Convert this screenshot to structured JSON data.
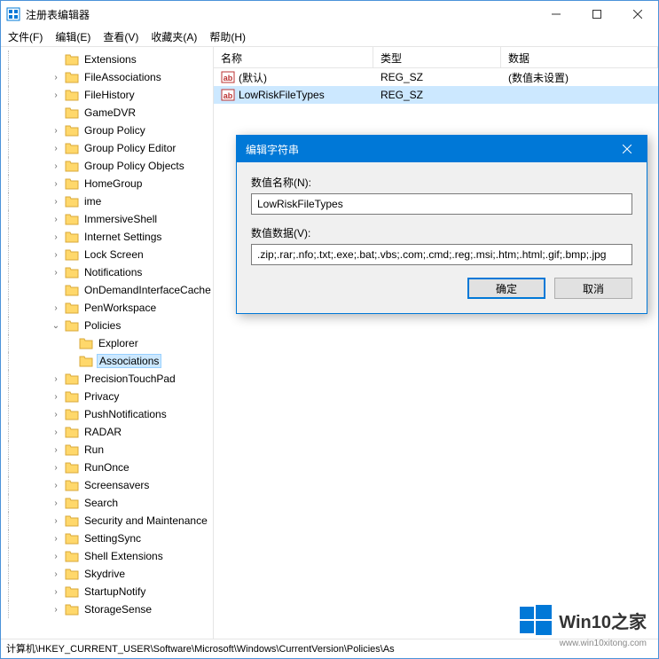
{
  "window": {
    "title": "注册表编辑器"
  },
  "menu": {
    "file": "文件(F)",
    "edit": "编辑(E)",
    "view": "查看(V)",
    "favorites": "收藏夹(A)",
    "help": "帮助(H)"
  },
  "tree": {
    "items": [
      {
        "indent": 3,
        "exp": "",
        "label": "Extensions"
      },
      {
        "indent": 3,
        "exp": ">",
        "label": "FileAssociations"
      },
      {
        "indent": 3,
        "exp": ">",
        "label": "FileHistory"
      },
      {
        "indent": 3,
        "exp": "",
        "label": "GameDVR"
      },
      {
        "indent": 3,
        "exp": ">",
        "label": "Group Policy"
      },
      {
        "indent": 3,
        "exp": ">",
        "label": "Group Policy Editor"
      },
      {
        "indent": 3,
        "exp": ">",
        "label": "Group Policy Objects"
      },
      {
        "indent": 3,
        "exp": ">",
        "label": "HomeGroup"
      },
      {
        "indent": 3,
        "exp": ">",
        "label": "ime"
      },
      {
        "indent": 3,
        "exp": ">",
        "label": "ImmersiveShell"
      },
      {
        "indent": 3,
        "exp": ">",
        "label": "Internet Settings"
      },
      {
        "indent": 3,
        "exp": ">",
        "label": "Lock Screen"
      },
      {
        "indent": 3,
        "exp": ">",
        "label": "Notifications"
      },
      {
        "indent": 3,
        "exp": "",
        "label": "OnDemandInterfaceCache"
      },
      {
        "indent": 3,
        "exp": ">",
        "label": "PenWorkspace"
      },
      {
        "indent": 3,
        "exp": "v",
        "label": "Policies"
      },
      {
        "indent": 4,
        "exp": "",
        "label": "Explorer"
      },
      {
        "indent": 4,
        "exp": "",
        "label": "Associations",
        "selected": true
      },
      {
        "indent": 3,
        "exp": ">",
        "label": "PrecisionTouchPad"
      },
      {
        "indent": 3,
        "exp": ">",
        "label": "Privacy"
      },
      {
        "indent": 3,
        "exp": ">",
        "label": "PushNotifications"
      },
      {
        "indent": 3,
        "exp": ">",
        "label": "RADAR"
      },
      {
        "indent": 3,
        "exp": ">",
        "label": "Run"
      },
      {
        "indent": 3,
        "exp": ">",
        "label": "RunOnce"
      },
      {
        "indent": 3,
        "exp": ">",
        "label": "Screensavers"
      },
      {
        "indent": 3,
        "exp": ">",
        "label": "Search"
      },
      {
        "indent": 3,
        "exp": ">",
        "label": "Security and Maintenance"
      },
      {
        "indent": 3,
        "exp": ">",
        "label": "SettingSync"
      },
      {
        "indent": 3,
        "exp": ">",
        "label": "Shell Extensions"
      },
      {
        "indent": 3,
        "exp": ">",
        "label": "Skydrive"
      },
      {
        "indent": 3,
        "exp": ">",
        "label": "StartupNotify"
      },
      {
        "indent": 3,
        "exp": ">",
        "label": "StorageSense"
      }
    ]
  },
  "list": {
    "columns": {
      "name": "名称",
      "type": "类型",
      "data": "数据"
    },
    "rows": [
      {
        "name": "(默认)",
        "type": "REG_SZ",
        "data": "(数值未设置)",
        "selected": false
      },
      {
        "name": "LowRiskFileTypes",
        "type": "REG_SZ",
        "data": "",
        "selected": true
      }
    ]
  },
  "dialog": {
    "title": "编辑字符串",
    "name_label": "数值名称(N):",
    "name_value": "LowRiskFileTypes",
    "data_label": "数值数据(V):",
    "data_value": ".zip;.rar;.nfo;.txt;.exe;.bat;.vbs;.com;.cmd;.reg;.msi;.htm;.html;.gif;.bmp;.jpg",
    "ok": "确定",
    "cancel": "取消"
  },
  "statusbar": {
    "path": "计算机\\HKEY_CURRENT_USER\\Software\\Microsoft\\Windows\\CurrentVersion\\Policies\\As"
  },
  "watermark": {
    "text": "Win10之家",
    "url": "www.win10xitong.com"
  }
}
